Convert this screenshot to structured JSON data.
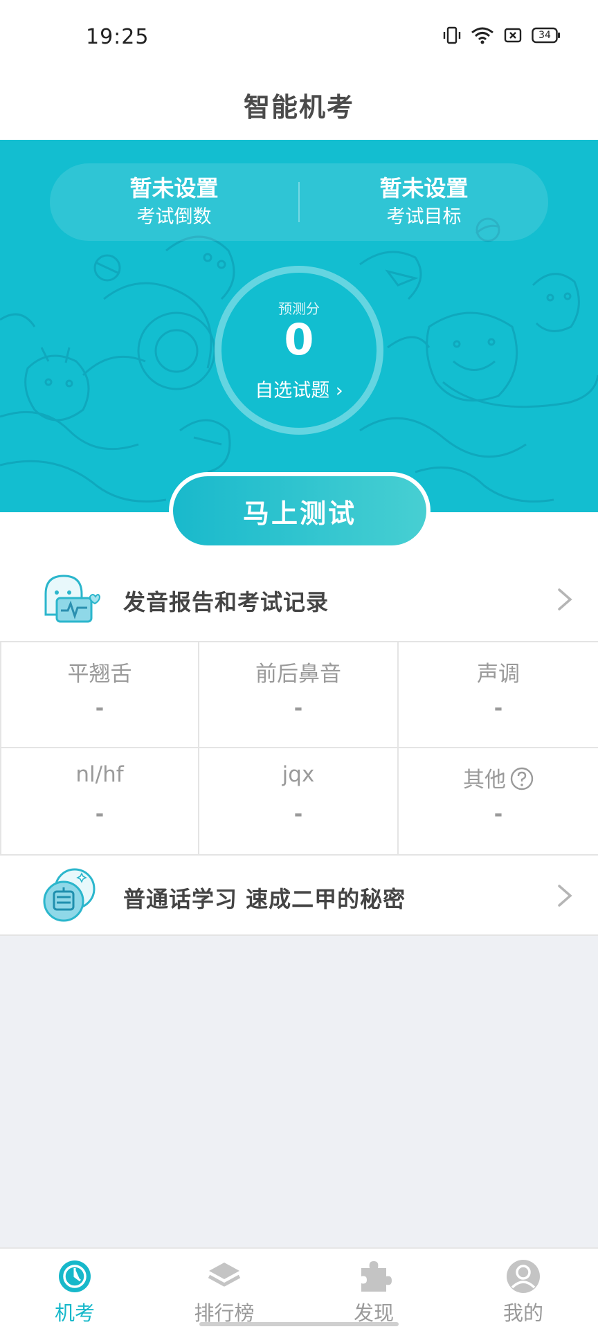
{
  "status_bar": {
    "time": "19:25",
    "battery": "34",
    "icons": [
      "vibrate-icon",
      "wifi-icon",
      "sim-icon",
      "battery-icon"
    ]
  },
  "header": {
    "title": "智能机考"
  },
  "hero": {
    "countdown_value": "暂未设置",
    "countdown_label": "考试倒数",
    "goal_value": "暂未设置",
    "goal_label": "考试目标",
    "score_label": "预测分",
    "score_value": "0",
    "select_questions": "自选试题 ›"
  },
  "test_button": "马上测试",
  "report_row": {
    "label": "发音报告和考试记录",
    "icon": "report-heartbeat-icon"
  },
  "stats": [
    {
      "title": "平翘舌",
      "value": "-"
    },
    {
      "title": "前后鼻音",
      "value": "-"
    },
    {
      "title": "声调",
      "value": "-"
    },
    {
      "title": "nl/hf",
      "value": "-"
    },
    {
      "title": "jqx",
      "value": "-"
    },
    {
      "title": "其他",
      "value": "-"
    }
  ],
  "study_row": {
    "label": "普通话学习 速成二甲的秘密",
    "icon": "putonghua-icon"
  },
  "nav": [
    {
      "label": "机考",
      "icon": "exam-icon",
      "active": true
    },
    {
      "label": "排行榜",
      "icon": "layers-icon",
      "active": false
    },
    {
      "label": "发现",
      "icon": "puzzle-icon",
      "active": false
    },
    {
      "label": "我的",
      "icon": "profile-icon",
      "active": false
    }
  ],
  "colors": {
    "accent": "#13bed0",
    "active_nav": "#17b8ca",
    "text": "#4a4a4a",
    "muted": "#9a9a9a",
    "page_bg": "#eef0f4"
  }
}
